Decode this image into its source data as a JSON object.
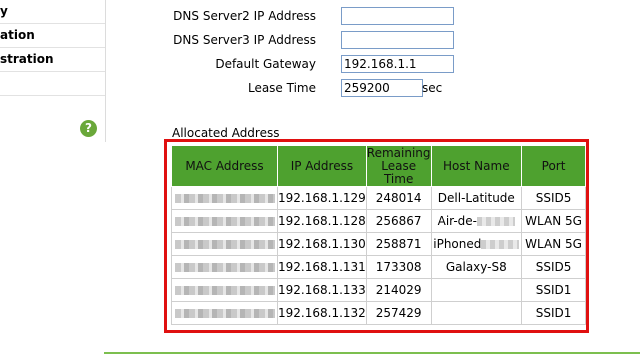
{
  "sidebar": {
    "items": [
      "y",
      "ation",
      "stration"
    ],
    "help_label": "?"
  },
  "form": {
    "dns2_label": "DNS Server2 IP Address",
    "dns2_value": "",
    "dns3_label": "DNS Server3 IP Address",
    "dns3_value": "",
    "gateway_label": "Default Gateway",
    "gateway_value": "192.168.1.1",
    "lease_label": "Lease Time",
    "lease_value": "259200",
    "lease_unit": "sec"
  },
  "allocated": {
    "title": "Allocated Address",
    "headers": [
      "MAC Address",
      "IP Address",
      "Remaining Lease Time",
      "Host Name",
      "Port"
    ],
    "rows": [
      {
        "ip": "192.168.1.129",
        "lease": "248014",
        "host": "Dell-Latitude",
        "port": "SSID5"
      },
      {
        "ip": "192.168.1.128",
        "lease": "256867",
        "host": "Air-de-",
        "port": "WLAN 5G"
      },
      {
        "ip": "192.168.1.130",
        "lease": "258871",
        "host": "iPhoned",
        "port": "WLAN 5G"
      },
      {
        "ip": "192.168.1.131",
        "lease": "173308",
        "host": "Galaxy-S8",
        "port": "SSID5"
      },
      {
        "ip": "192.168.1.133",
        "lease": "214029",
        "host": "",
        "port": "SSID1"
      },
      {
        "ip": "192.168.1.132",
        "lease": "257429",
        "host": "",
        "port": "SSID1"
      }
    ]
  },
  "colors": {
    "header_green": "#4ea12f",
    "highlight_red": "#e01010",
    "help_green": "#6aa83a"
  }
}
